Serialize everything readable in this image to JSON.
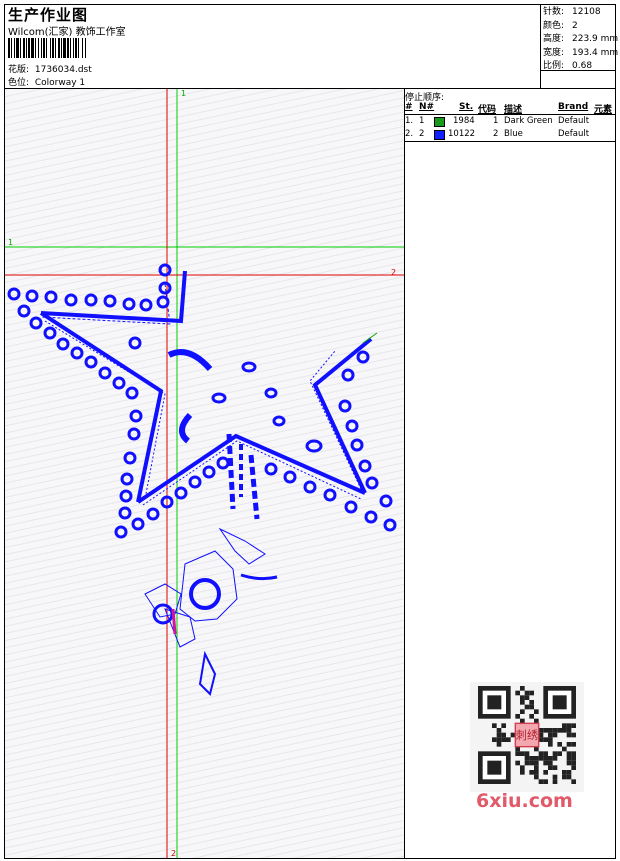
{
  "header": {
    "title": "生产作业图",
    "studio": "Wilcom(汇家) 教饰工作室",
    "design_label": "花版:",
    "design_file": "1736034.dst",
    "color_label": "色位:",
    "colorway": "Colorway 1"
  },
  "stats": [
    {
      "label": "针数:",
      "value": "12108"
    },
    {
      "label": "颜色:",
      "value": "2"
    },
    {
      "label": "高度:",
      "value": "223.9 mm"
    },
    {
      "label": "宽度:",
      "value": "193.4 mm"
    },
    {
      "label": "比例:",
      "value": "0.68"
    }
  ],
  "canvas": {
    "guide_v_green": "1",
    "guide_h_green": "1",
    "guide_h_red": "2",
    "guide_v_red": "2",
    "colors": {
      "green": "#00cc00",
      "red": "#e00000",
      "stitch": "#1010ff",
      "accent": "#d0149a"
    }
  },
  "stop_sequence": {
    "title": "停止顺序:",
    "columns": [
      "#",
      "N#",
      "St.",
      "代码",
      "描述",
      "Brand",
      "元素"
    ],
    "rows": [
      {
        "index": "1.",
        "needle": "1",
        "color": "#1a9a1a",
        "stitches": "1984",
        "code": "1",
        "description": "Dark Green",
        "brand": "Default"
      },
      {
        "index": "2.",
        "needle": "2",
        "color": "#1020ff",
        "stitches": "10122",
        "code": "2",
        "description": "Blue",
        "brand": "Default"
      }
    ]
  },
  "watermark": {
    "site": "6xiu.com",
    "stamp": "刺绣"
  }
}
